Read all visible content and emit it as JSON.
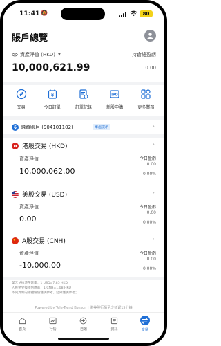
{
  "status": {
    "time": "11:41",
    "battery": "80"
  },
  "header": {
    "title": "賬戶總覽"
  },
  "summary": {
    "nav_label": "資產淨值 (HKD)",
    "nav_value": "10,000,621.99",
    "pnl_label": "持倉總盈虧",
    "pnl_value": "0.00"
  },
  "actions": [
    {
      "label": "交易",
      "icon": "trade-icon"
    },
    {
      "label": "今日訂單",
      "icon": "calendar-icon"
    },
    {
      "label": "訂單記錄",
      "icon": "order-record-icon"
    },
    {
      "label": "新股申購",
      "icon": "ipo-icon"
    },
    {
      "label": "更多業務",
      "icon": "grid-icon"
    }
  ],
  "margin": {
    "label": "融資賬戶 (904101102)",
    "badge": "單溫提示"
  },
  "markets": [
    {
      "name": "港股交易 (HKD)",
      "nav_label": "資產淨值",
      "nav_value": "10,000,062.00",
      "pnl_label": "今日盈虧",
      "pnl_value": "0.00",
      "pnl_pct": "0.00%",
      "flag": "hk-flag-icon"
    },
    {
      "name": "美股交易 (USD)",
      "nav_label": "資產淨值",
      "nav_value": "0.00",
      "pnl_label": "今日盈虧",
      "pnl_value": "0.00",
      "pnl_pct": "0.00%",
      "flag": "us-flag-icon"
    },
    {
      "name": "A股交易 (CNH)",
      "nav_label": "資產淨值",
      "nav_value": "-10,000.00",
      "pnl_label": "今日盈虧",
      "pnl_value": "0.00",
      "pnl_pct": "0.00%",
      "flag": "cn-flag-icon"
    }
  ],
  "notes": {
    "line1": "美元兌換港幣匯率：1 USD=7.85 HKD",
    "line2": "人民幣兌換港幣匯率：1 CNH=1.08 HKD",
    "line3": "不同貨幣的總體價值僅供參考，結果僅供參考；"
  },
  "powered": "Powered by Tele-Trend Konson | 港美股行情至少延遲15分鐘",
  "tabs": [
    {
      "label": "首頁",
      "icon": "home-icon"
    },
    {
      "label": "行情",
      "icon": "chart-icon"
    },
    {
      "label": "自選",
      "icon": "plus-circle-icon"
    },
    {
      "label": "資訊",
      "icon": "news-icon"
    },
    {
      "label": "交易",
      "icon": "trade-tab-icon",
      "active": true
    }
  ],
  "colors": {
    "accent": "#1f6fd6",
    "battery": "#f3d21a"
  }
}
